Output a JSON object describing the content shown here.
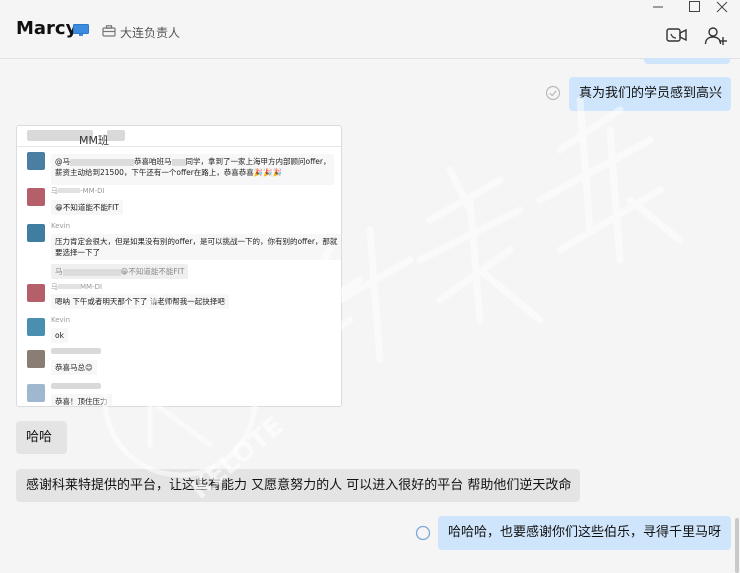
{
  "header": {
    "contact_name": "Marcy",
    "org_label": "大连负责人",
    "icons": [
      "monitor-icon",
      "organization-icon",
      "video-call-icon",
      "add-contact-icon",
      "window-minimize-icon",
      "window-maximize-icon",
      "window-close-icon"
    ]
  },
  "messages": {
    "m1": "真为我们的学员感到高兴",
    "m2": "哈哈",
    "m3": "感谢科莱特提供的平台，让这些有能力 又愿意努力的人 可以进入很好的平台 帮助他们逆天改命",
    "m4": "哈哈哈，也要感谢你们这些伯乐，寻得千里马呀"
  },
  "screenshot": {
    "title": "MM班",
    "lines": {
      "l1a": "@马",
      "l1b": "恭喜咱班马",
      "l1c": "同学，拿到了一家上海甲方内部顾问offer，",
      "l1d": "薪资主动给到21500，下午还有一个offer在路上，恭喜恭喜🎉🎉🎉",
      "n2": "马",
      "n2b": "-MM-DI",
      "l2": "😁不知道能不能FIT",
      "n3": "Kevin",
      "l3a": "压力肯定会很大，但是如果没有别的offer，是可以挑战一下的，你有别的offer，那就",
      "l3b": "要选择一下了",
      "q1": "马",
      "q1b": "😁不知道能不能FIT",
      "n4": "马",
      "n4b": "MM-DI",
      "l4": "嗯呐 下午或者明天那个下了 请老师帮我一起抉择吧",
      "n5": "Kevin",
      "l5": "ok",
      "l6": "恭喜马总😊",
      "l7": "恭喜！顶住压力"
    }
  },
  "colors": {
    "bubble_me": "#cfe5fb",
    "bubble_them": "#e4e4e4",
    "background": "#f5f5f5"
  },
  "watermark_text": "KELOTE"
}
